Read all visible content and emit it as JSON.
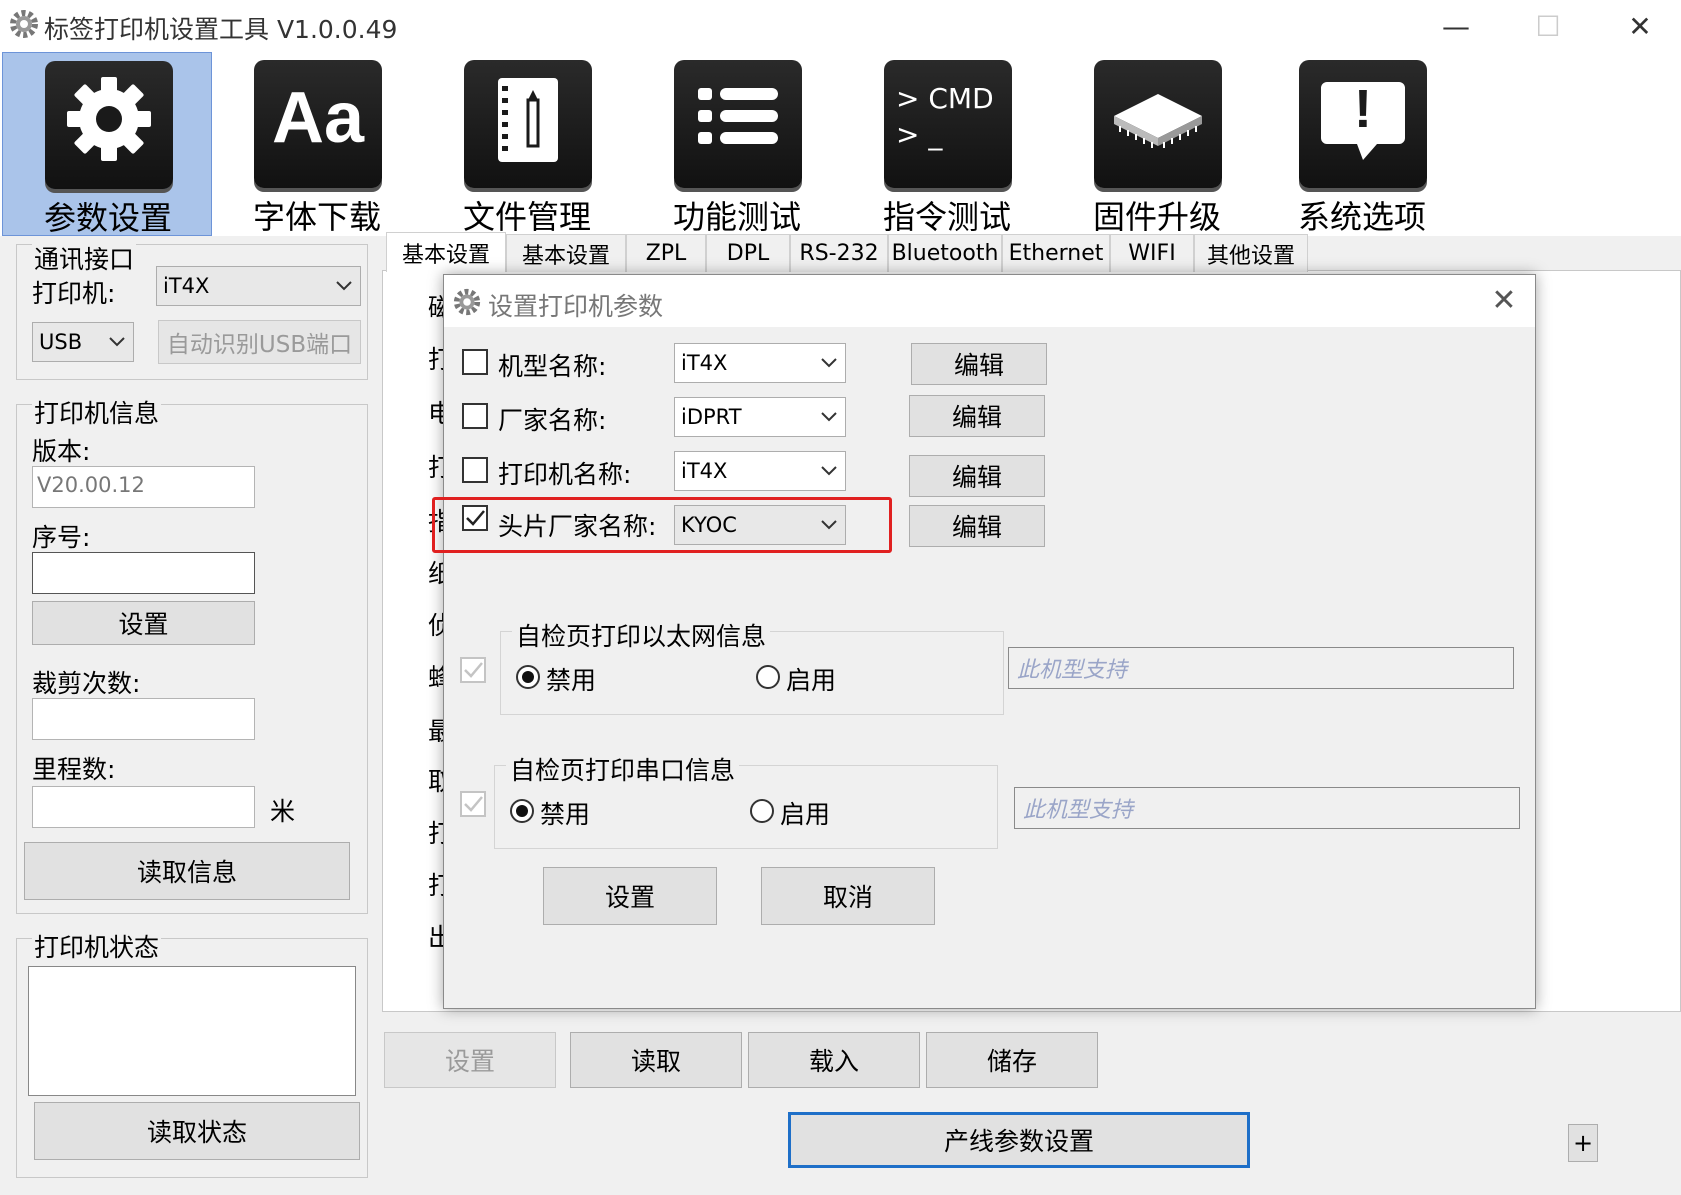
{
  "window": {
    "title": "标签打印机设置工具  V1.0.0.49"
  },
  "toolbar": [
    {
      "label": "参数设置",
      "icon": "gear-icon"
    },
    {
      "label": "字体下载",
      "icon": "font-icon",
      "glyph": "Aa"
    },
    {
      "label": "文件管理",
      "icon": "file-icon"
    },
    {
      "label": "功能测试",
      "icon": "list-icon"
    },
    {
      "label": "指令测试",
      "icon": "cmd-icon",
      "glyph1": "> CMD",
      "glyph2": "> _"
    },
    {
      "label": "固件升级",
      "icon": "chip-icon"
    },
    {
      "label": "系统选项",
      "icon": "alert-icon",
      "glyph": "!"
    }
  ],
  "comm": {
    "title": "通讯接口",
    "printer_label": "打印机:",
    "printer_value": "iT4X",
    "port_value": "USB",
    "auto_detect": "自动识别USB端口"
  },
  "info": {
    "title": "打印机信息",
    "version_label": "版本:",
    "version_value": "V20.00.12",
    "serial_label": "序号:",
    "set_btn": "设置",
    "cut_label": "裁剪次数:",
    "mileage_label": "里程数:",
    "mileage_unit": "米",
    "read_btn": "读取信息"
  },
  "status": {
    "title": "打印机状态",
    "read_btn": "读取状态"
  },
  "tabs": [
    "基本设置",
    "基本设置",
    "ZPL",
    "DPL",
    "RS-232",
    "Bluetooth",
    "Ethernet",
    "WIFI",
    "其他设置"
  ],
  "behind_labels": [
    "磁",
    "打",
    "电",
    "打",
    "指",
    "纸",
    "侦",
    "蜂",
    "最",
    "取",
    "打",
    "打",
    "出"
  ],
  "bottom": {
    "set": "设置",
    "read": "读取",
    "load": "载入",
    "save": "储存",
    "line_params": "产线参数设置",
    "plus": "+"
  },
  "dialog": {
    "title": "设置打印机参数",
    "rows": [
      {
        "label": "机型名称:",
        "value": "iT4X",
        "checked": false,
        "edit": "编辑"
      },
      {
        "label": "厂家名称:",
        "value": "iDPRT",
        "checked": false,
        "edit": "编辑"
      },
      {
        "label": "打印机名称:",
        "value": "iT4X",
        "checked": false,
        "edit": "编辑"
      },
      {
        "label": "头片厂家名称:",
        "value": "KYOC",
        "checked": true,
        "edit": "编辑"
      }
    ],
    "group1": {
      "title": "自检页打印以太网信息",
      "disable": "禁用",
      "enable": "启用",
      "hint": "此机型支持"
    },
    "group2": {
      "title": "自检页打印串口信息",
      "disable": "禁用",
      "enable": "启用",
      "hint": "此机型支持"
    },
    "ok": "设置",
    "cancel": "取消"
  },
  "colors": {
    "highlight": "#e02020",
    "active_tool": "#aac4ea",
    "focus": "#1e6fc8"
  }
}
